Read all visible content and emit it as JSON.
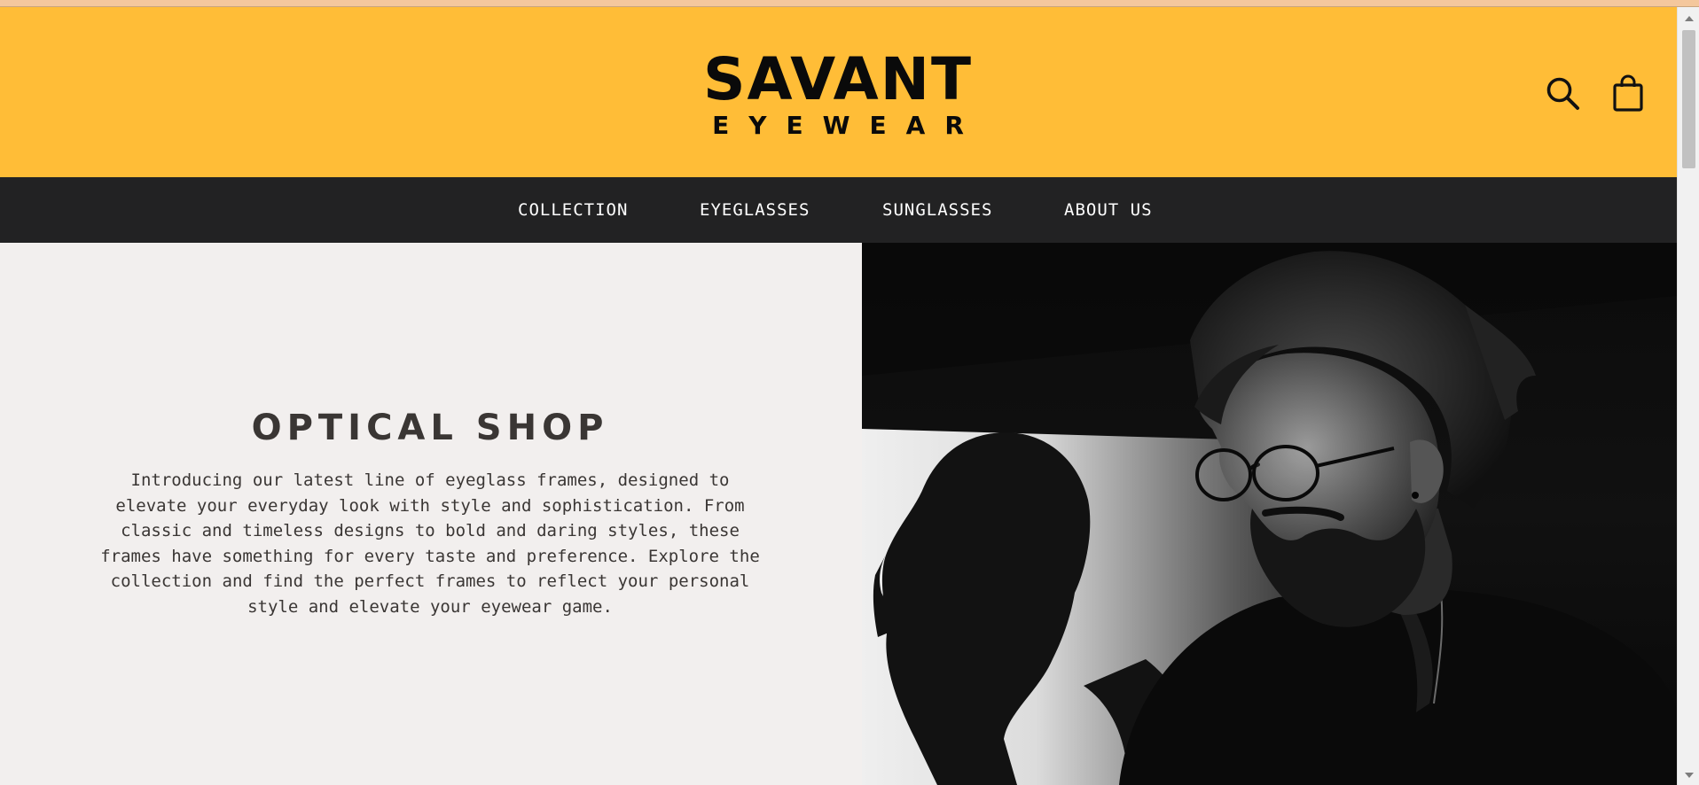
{
  "brand": {
    "name": "SAVANT",
    "tagline": "EYEWEAR"
  },
  "header": {
    "search_icon": "search-icon",
    "cart_icon": "shopping-bag-icon",
    "background_color": "#ffbd37"
  },
  "nav": {
    "background_color": "#222223",
    "items": [
      {
        "label": "COLLECTION"
      },
      {
        "label": "EYEGLASSES"
      },
      {
        "label": "SUNGLASSES"
      },
      {
        "label": "ABOUT US"
      }
    ]
  },
  "hero": {
    "title": "OPTICAL SHOP",
    "description": "Introducing our latest line of eyeglass frames, designed to elevate your everyday look with style and sophistication. From classic and timeless designs to bold and daring styles, these frames have something for every taste and preference. Explore the collection and find the perfect frames to reflect your personal style and elevate your eyewear game.",
    "background_color": "#f2efee",
    "photo": "black-and-white-portrait-bearded-man-wearing-eyeglasses"
  }
}
